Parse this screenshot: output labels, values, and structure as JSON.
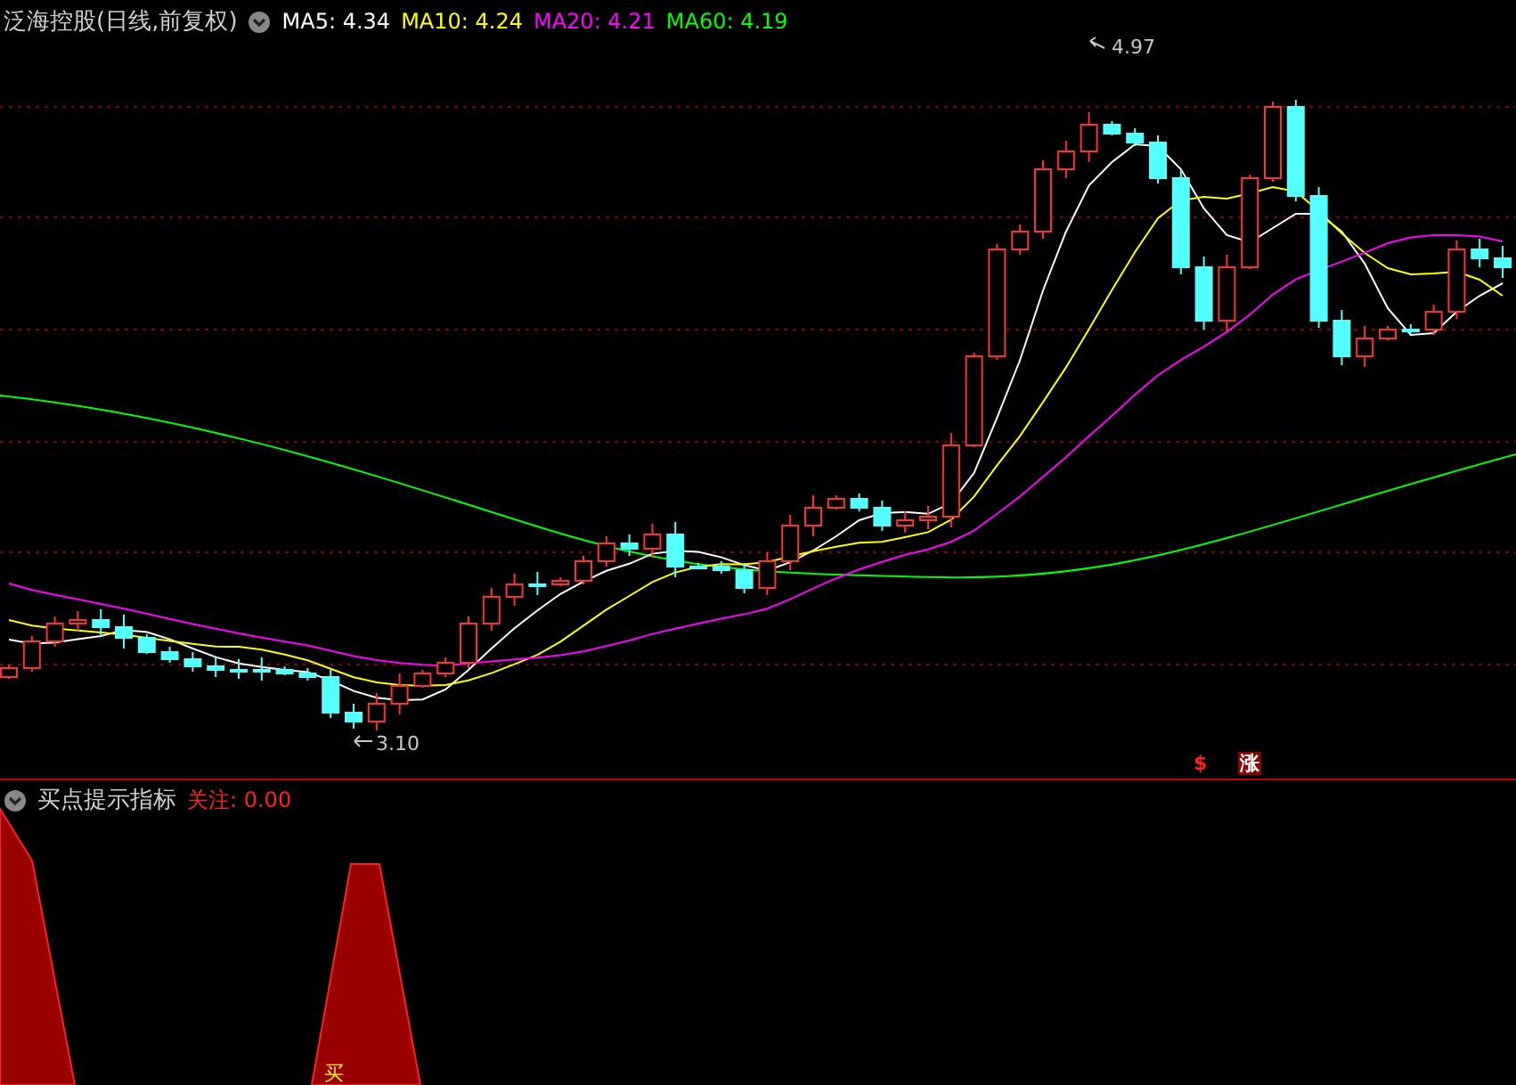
{
  "header": {
    "title": "泛海控股(日线,前复权)",
    "indicators": [
      {
        "label": "MA5: 4.34",
        "color": "#ffffff"
      },
      {
        "label": "MA10: 4.24",
        "color": "#ffff00"
      },
      {
        "label": "MA20: 4.21",
        "color": "#ff00ff"
      },
      {
        "label": "MA60: 4.19",
        "color": "#00ff00"
      }
    ]
  },
  "price_chart": {
    "high_label": "4.97",
    "low_label": "3.10",
    "markers": [
      {
        "kind": "dollar",
        "text": "$"
      },
      {
        "kind": "rise",
        "text": "涨"
      }
    ]
  },
  "indicator_panel": {
    "title": "买点提示指标",
    "reading": "关注: 0.00",
    "signal_label": "买"
  }
}
